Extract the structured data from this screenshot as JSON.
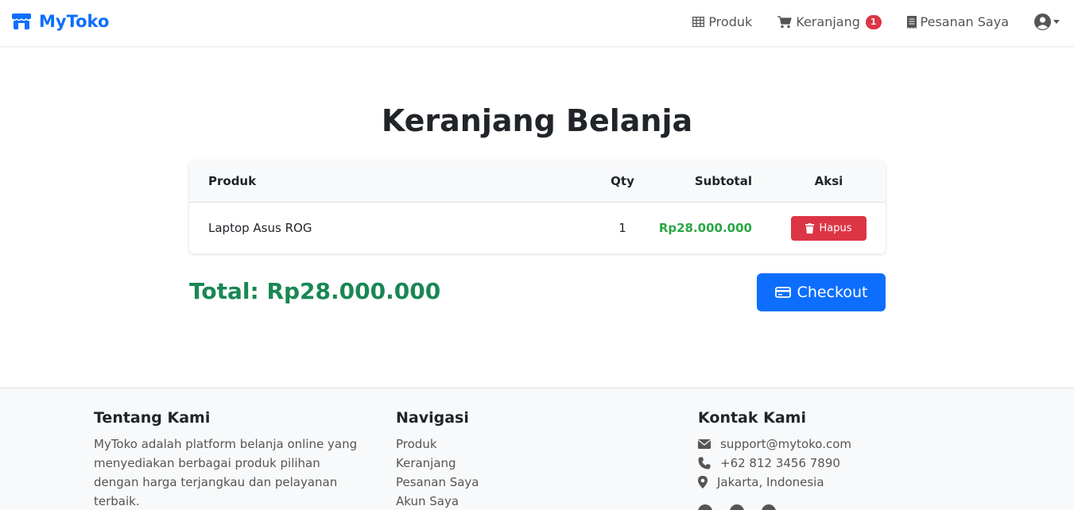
{
  "navbar": {
    "brand": "MyToko",
    "links": {
      "produk": "Produk",
      "keranjang": "Keranjang",
      "keranjang_badge": "1",
      "pesanan": "Pesanan Saya"
    }
  },
  "page_title": "Keranjang Belanja",
  "cart": {
    "headers": {
      "produk": "Produk",
      "qty": "Qty",
      "subtotal": "Subtotal",
      "aksi": "Aksi"
    },
    "items": [
      {
        "produk": "Laptop Asus ROG",
        "qty": "1",
        "subtotal": "Rp28.000.000",
        "action": "Hapus"
      }
    ],
    "total": "Total: Rp28.000.000",
    "checkout": "Checkout"
  },
  "footer": {
    "about": {
      "title": "Tentang Kami",
      "text": "MyToko adalah platform belanja online yang menyediakan berbagai produk pilihan dengan harga terjangkau dan pelayanan terbaik."
    },
    "navigation": {
      "title": "Navigasi",
      "links": [
        "Produk",
        "Keranjang",
        "Pesanan Saya",
        "Akun Saya"
      ]
    },
    "contact": {
      "title": "Kontak Kami",
      "email": "support@mytoko.com",
      "phone": "+62 812 3456 7890",
      "location": "Jakarta, Indonesia"
    }
  },
  "colors": {
    "primary": "#0d6efd",
    "danger": "#dc3545",
    "success": "#198754",
    "subtotal": "#28a745"
  },
  "icons": {
    "brand": "store-icon",
    "produk": "grid-icon",
    "keranjang": "cart-icon",
    "pesanan": "receipt-icon",
    "user": "user-circle-icon",
    "hapus": "trash-icon",
    "checkout": "credit-card-icon",
    "email": "envelope-icon",
    "phone": "phone-icon",
    "location": "map-marker-icon"
  }
}
